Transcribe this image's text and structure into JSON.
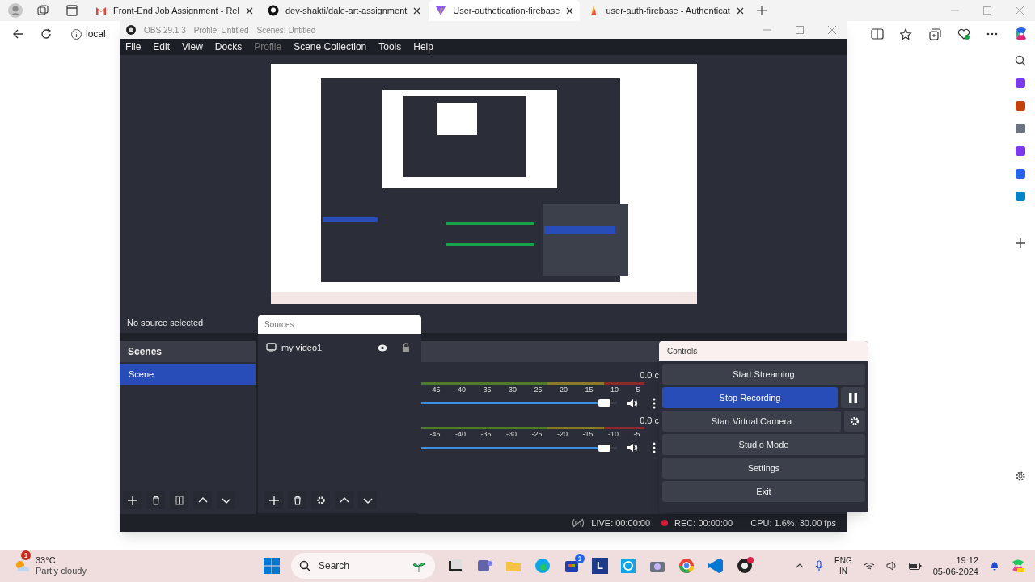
{
  "browser": {
    "tabs": [
      {
        "label": "Front-End Job Assignment - Rel",
        "selected": false
      },
      {
        "label": "dev-shakti/dale-art-assignment",
        "selected": false
      },
      {
        "label": "User-authetication-firebase",
        "selected": true
      },
      {
        "label": "user-auth-firebase - Authenticat",
        "selected": false
      }
    ],
    "address": "local"
  },
  "obs": {
    "title": "OBS 29.1.3",
    "profile": "Profile: Untitled",
    "scenes_label": "Scenes: Untitled",
    "menu": [
      {
        "label": "File",
        "disabled": false
      },
      {
        "label": "Edit",
        "disabled": false
      },
      {
        "label": "View",
        "disabled": false
      },
      {
        "label": "Docks",
        "disabled": false
      },
      {
        "label": "Profile",
        "disabled": true
      },
      {
        "label": "Scene Collection",
        "disabled": false
      },
      {
        "label": "Tools",
        "disabled": false
      },
      {
        "label": "Help",
        "disabled": false
      }
    ],
    "source_status": "No source selected",
    "scenes": {
      "title": "Scenes",
      "items": [
        {
          "label": "Scene",
          "selected": true
        }
      ]
    },
    "sources": {
      "title": "Sources",
      "items": [
        {
          "label": "my video1",
          "visible": true,
          "locked": true
        }
      ]
    },
    "mixer": {
      "channels": [
        {
          "reading": "0.0 c",
          "ticks": [
            "-45",
            "-40",
            "-35",
            "-30",
            "-25",
            "-20",
            "-15",
            "-10",
            "-5"
          ],
          "level": 0.97
        },
        {
          "reading": "0.0 c",
          "ticks": [
            "-45",
            "-40",
            "-35",
            "-30",
            "-25",
            "-20",
            "-15",
            "-10",
            "-5"
          ],
          "level": 0.97
        }
      ]
    },
    "controls": {
      "title": "Controls",
      "buttons": [
        {
          "label": "Start Streaming",
          "kind": "plain",
          "active": false
        },
        {
          "label": "Stop Recording",
          "kind": "pause",
          "active": true
        },
        {
          "label": "Start Virtual Camera",
          "kind": "gear",
          "active": false
        },
        {
          "label": "Studio Mode",
          "kind": "plain",
          "active": false
        },
        {
          "label": "Settings",
          "kind": "plain",
          "active": false
        },
        {
          "label": "Exit",
          "kind": "plain",
          "active": false
        }
      ]
    },
    "status_bar": {
      "live": "LIVE: 00:00:00",
      "rec": "REC: 00:00:00",
      "cpu": "CPU: 1.6%, 30.00 fps"
    }
  },
  "taskbar": {
    "weather": {
      "temperature": "33°C",
      "condition": "Partly cloudy",
      "badge": "1"
    },
    "search": "Search",
    "store_badge": "1",
    "app_letter": "L",
    "language": "ENG",
    "region": "IN",
    "time": "19:12",
    "date": "05-06-2024"
  }
}
